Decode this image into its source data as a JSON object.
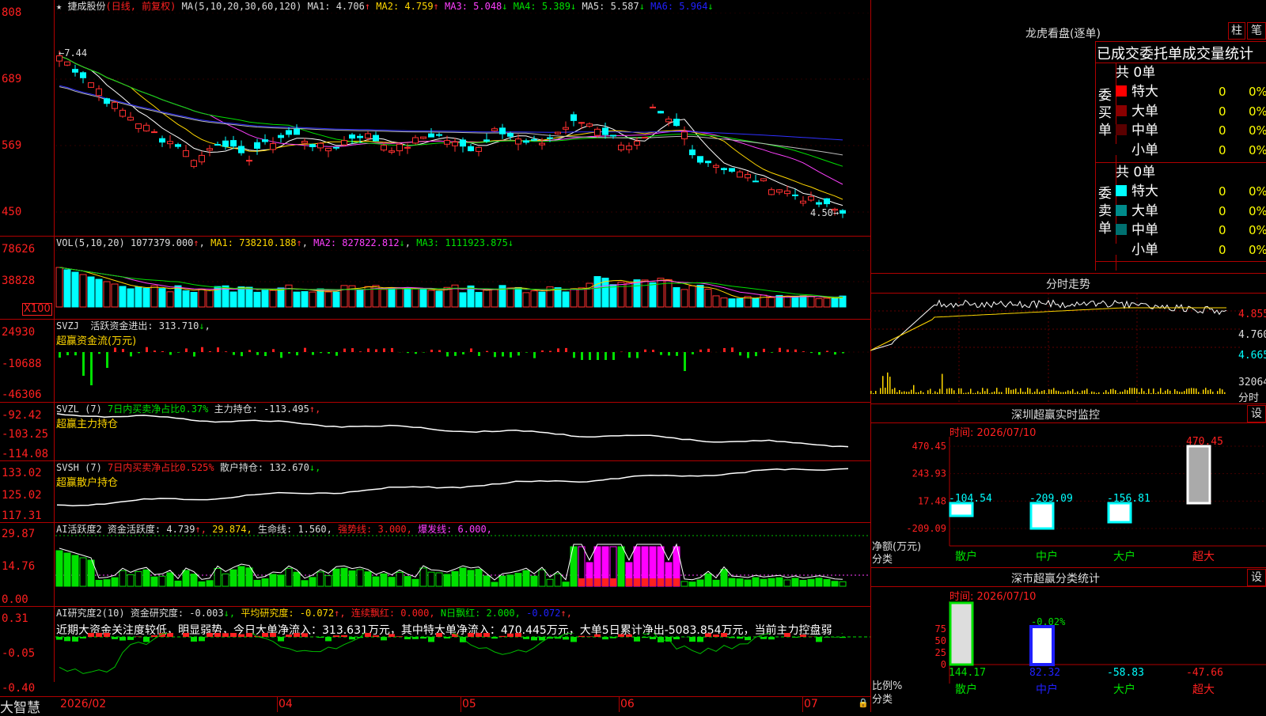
{
  "stock": {
    "name": "捷成股份",
    "period": "(日线, 前复权)",
    "star": "★"
  },
  "main_chart": {
    "ma_title": "MA(5,10,20,30,60,120)",
    "ma1": "MA1: 4.706",
    "ma2": "MA2: 4.759",
    "ma3": "MA3: 5.048",
    "ma4": "MA4: 5.389",
    "ma5": "MA5: 5.587",
    "ma6": "MA6: 5.964",
    "ma1_arrow": "↑",
    "ma2_arrow": "↑",
    "ma3_arrow": "↓",
    "ma4_arrow": "↓",
    "ma5_arrow": "↓",
    "ma6_arrow": "↓",
    "y_ticks": [
      "808",
      "689",
      "569",
      "450"
    ],
    "high_label": "←7.44",
    "low_label": "4.50→"
  },
  "vol": {
    "title": "VOL(5,10,20)",
    "value": "1077379.000",
    "va": "↑",
    "ma1": "MA1: 738210.188",
    "ma1a": "↑",
    "ma2": "MA2: 827822.812",
    "ma2a": "↓",
    "ma3": "MA3: 1111923.875",
    "ma3a": "↓",
    "y_ticks": [
      "78626",
      "38828"
    ],
    "unit": "X100"
  },
  "svzj": {
    "title": "SVZJ",
    "label": "活跃资金进出: 313.710",
    "arrow": "↓",
    "subtitle": "超赢资金流(万元)",
    "y_ticks": [
      "24930",
      "-10688",
      "-46306"
    ]
  },
  "svzl": {
    "title": "SVZL (7)",
    "ratio": "7日内买卖净占比0.37%",
    "label": "主力持仓: -113.495",
    "arrow": "↑,",
    "subtitle": "超赢主力持仓",
    "y_ticks": [
      "-92.42",
      "-103.25",
      "-114.08"
    ]
  },
  "svsh": {
    "title": "SVSH (7)",
    "ratio": "7日内买卖净占比0.525%",
    "label": "散户持仓: 132.670",
    "arrow": "↓,",
    "subtitle": "超赢散户持仓",
    "y_ticks": [
      "133.02",
      "125.02",
      "117.31"
    ]
  },
  "ai_active": {
    "title": "AI活跃度2",
    "l1": "资金活跃度: 4.739",
    "l1a": "↑,",
    "l2": "29.874,",
    "l3": "生命线: 1.560,",
    "l4": "强势线: 3.000,",
    "l5": "爆发线: 6.000,",
    "y_ticks": [
      "29.87",
      "14.76",
      "0.00"
    ]
  },
  "ai_research": {
    "title": "AI研究度2(10)",
    "l1": "资金研究度: -0.003",
    "l1a": "↓,",
    "l2": "平均研究度: -0.072",
    "l2a": "↑,",
    "l3": "连续飘红: 0.000,",
    "l4": "N日飘红: 2.000,",
    "l5": "-0.072",
    "l5a": "↑,",
    "commentary": "近期大资金关注度较低，明显弱势，今日大单净流入：313.631万元，其中特大单净流入：470.445万元，大单5日累计净出-5083.854万元，当前主力控盘弱",
    "y_ticks": [
      "0.31",
      "-0.05",
      "-0.40"
    ]
  },
  "time_axis": [
    "2026/02",
    "04",
    "05",
    "06",
    "07"
  ],
  "brand": "大智慧",
  "lhb": {
    "title": "龙虎看盘(逐单)",
    "btn1": "柱",
    "btn2": "笔",
    "subtitle": "已成交委托单成交量统计",
    "buy_label": "委买单",
    "sell_label": "委卖单",
    "buy_total": "共 0单",
    "sell_total": "共 0单",
    "buy_rows": [
      {
        "name": "特大",
        "v": "0",
        "p": "0%",
        "color": "#ff0000"
      },
      {
        "name": "大单",
        "v": "0",
        "p": "0%",
        "color": "#8b0000"
      },
      {
        "name": "中单",
        "v": "0",
        "p": "0%",
        "color": "#5a0000"
      },
      {
        "name": "小单",
        "v": "0",
        "p": "0%",
        "color": "#000000"
      }
    ],
    "sell_rows": [
      {
        "name": "特大",
        "v": "0",
        "p": "0%",
        "color": "#00ffff"
      },
      {
        "name": "大单",
        "v": "0",
        "p": "0%",
        "color": "#008b8b"
      },
      {
        "name": "中单",
        "v": "0",
        "p": "0%",
        "color": "#007070"
      },
      {
        "name": "小单",
        "v": "0",
        "p": "0%",
        "color": "#000000"
      }
    ]
  },
  "intraday": {
    "title": "分时走势",
    "y_ticks": [
      "4.855",
      "4.760",
      "4.665"
    ],
    "vol_tick": "32064",
    "unit": "分时"
  },
  "sz_monitor": {
    "title": "深圳超赢实时监控",
    "btn": "设",
    "date": "时间: 2026/07/10",
    "y_ticks": [
      "470.45",
      "243.93",
      "17.48",
      "-209.09"
    ],
    "axis_label1": "净额(万元)",
    "axis_label2": "分类",
    "bars": [
      {
        "cat": "散户",
        "val": "-104.54",
        "num": -104.54
      },
      {
        "cat": "中户",
        "val": "-209.09",
        "num": -209.09
      },
      {
        "cat": "大户",
        "val": "-156.81",
        "num": -156.81
      },
      {
        "cat": "超大",
        "val": "470.45",
        "num": 470.45
      }
    ]
  },
  "sz_class": {
    "title": "深市超赢分类统计",
    "btn": "设",
    "date": "时间: 2026/07/10",
    "y_ticks": [
      "75",
      "50",
      "25",
      "0"
    ],
    "axis_label1": "比例%",
    "axis_label2": "分类",
    "bar_labels": [
      "",
      "-0.02%"
    ],
    "cats": [
      "散户",
      "中户",
      "大户",
      "超大"
    ],
    "vals": [
      "144.17",
      "82.32",
      "-58.83",
      "-47.66"
    ]
  }
}
